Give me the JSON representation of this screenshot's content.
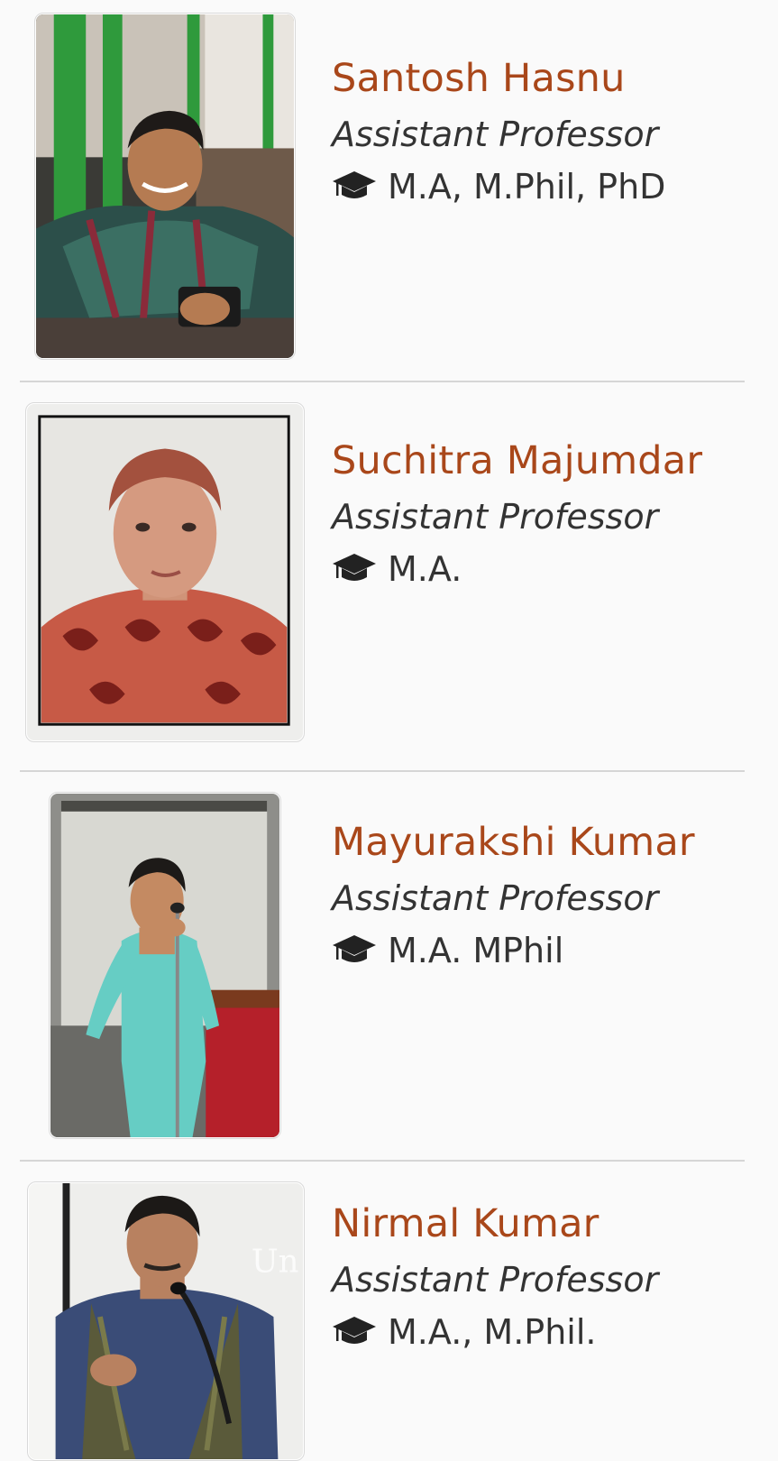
{
  "faculty": [
    {
      "name": "Santosh Hasnu",
      "designation": "Assistant Professor",
      "qualification": "M.A, M.Phil, PhD",
      "photo_alt": "Santosh Hasnu photo"
    },
    {
      "name": "Suchitra Majumdar",
      "designation": "Assistant Professor",
      "qualification": "M.A.",
      "photo_alt": "Suchitra Majumdar photo"
    },
    {
      "name": "Mayurakshi Kumar",
      "designation": "Assistant Professor",
      "qualification": "M.A. MPhil",
      "photo_alt": "Mayurakshi Kumar photo"
    },
    {
      "name": "Nirmal Kumar",
      "designation": "Assistant Professor",
      "qualification": "M.A., M.Phil.",
      "photo_alt": "Nirmal Kumar photo"
    }
  ],
  "qualification_icon": "graduation-cap-icon",
  "colors": {
    "name": "#a9471a",
    "text": "#333333",
    "divider": "#d6d6d6",
    "background": "#fafafa"
  }
}
